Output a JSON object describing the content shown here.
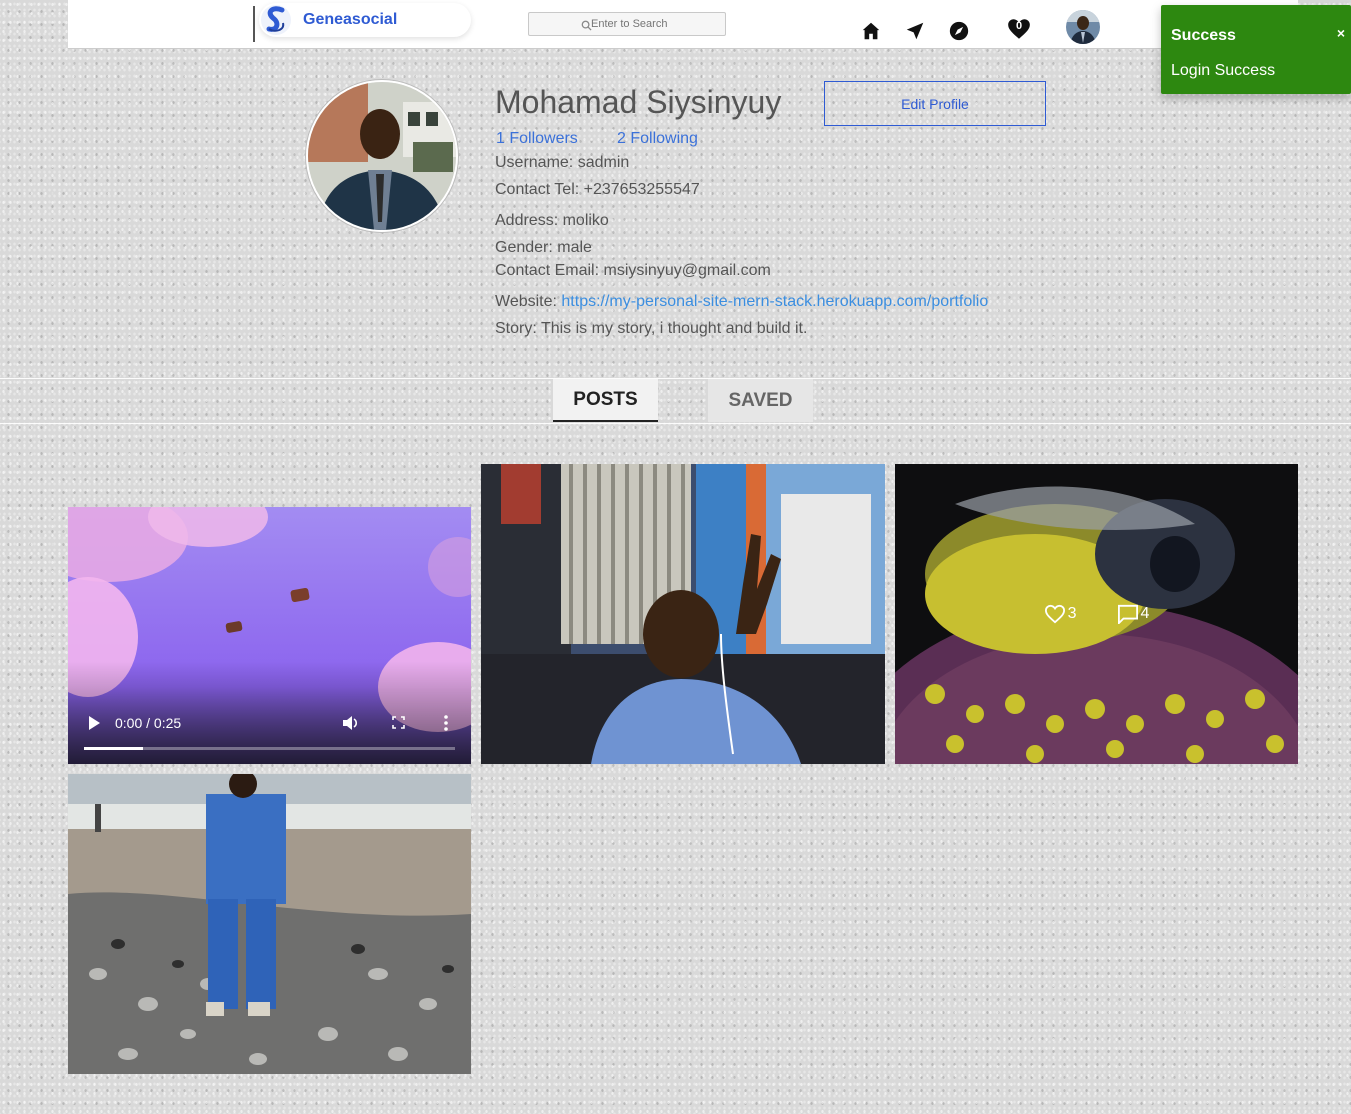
{
  "header": {
    "brand": "Geneasocial",
    "search_placeholder": "Enter to Search",
    "notification_count": "0",
    "nav": [
      "home-icon",
      "send-icon",
      "explore-icon",
      "heart-icon",
      "avatar"
    ]
  },
  "toast": {
    "title": "Success",
    "message": "Login Success",
    "close": "×",
    "color": "#2d8810"
  },
  "profile": {
    "fullname": "Mohamad Siysinyuy",
    "edit_label": "Edit Profile",
    "followers": "1 Followers",
    "following": "2 Following",
    "username": "Username: sadmin",
    "tel": "Contact Tel: +237653255547",
    "address": "Address: moliko",
    "gender": "Gender: male",
    "email": "Contact Email: msiysinyuy@gmail.com",
    "website_label": "Website: ",
    "website_url": "https://my-personal-site-mern-stack.herokuapp.com/portfolio",
    "story": "Story: This is my story, i thought and build it."
  },
  "tabs": {
    "posts": "POSTS",
    "saved": "SAVED"
  },
  "posts": {
    "video": {
      "time": "0:00 / 0:25",
      "progress": 0.16
    },
    "bee": {
      "likes": "3",
      "comments": "4"
    }
  },
  "colors": {
    "accent": "#2f5bd3",
    "link": "#3b71d9"
  }
}
